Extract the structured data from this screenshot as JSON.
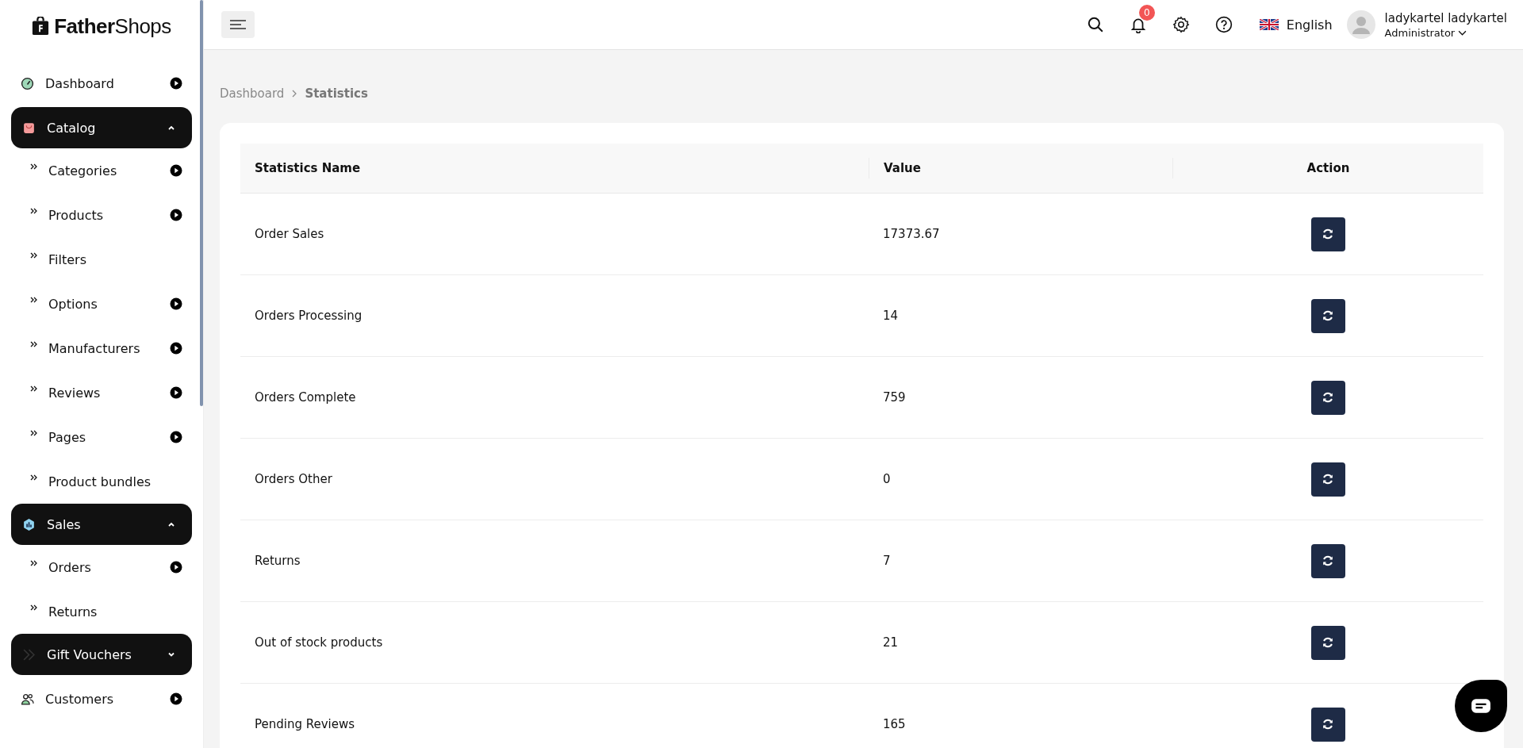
{
  "brand": {
    "name_bold": "Father",
    "name_light": "Shops"
  },
  "sidebar": {
    "items": [
      {
        "label": "Dashboard",
        "kind": "link",
        "has_arrow": true
      },
      {
        "label": "Catalog",
        "kind": "group",
        "expanded": true,
        "children": [
          {
            "label": "Categories",
            "has_arrow": true
          },
          {
            "label": "Products",
            "has_arrow": true
          },
          {
            "label": "Filters",
            "has_arrow": false
          },
          {
            "label": "Options",
            "has_arrow": true
          },
          {
            "label": "Manufacturers",
            "has_arrow": true
          },
          {
            "label": "Reviews",
            "has_arrow": true
          },
          {
            "label": "Pages",
            "has_arrow": true
          },
          {
            "label": "Product bundles",
            "has_arrow": false
          }
        ]
      },
      {
        "label": "Sales",
        "kind": "group",
        "expanded": true,
        "children": [
          {
            "label": "Orders",
            "has_arrow": true
          },
          {
            "label": "Returns",
            "has_arrow": false
          }
        ]
      },
      {
        "label": "Gift Vouchers",
        "kind": "group",
        "expanded": false
      },
      {
        "label": "Customers",
        "kind": "link",
        "has_arrow": true
      }
    ]
  },
  "header": {
    "notification_count": "0",
    "language": "English",
    "user_name": "ladykartel ladykartel",
    "user_role": "Administrator"
  },
  "breadcrumb": [
    {
      "label": "Dashboard",
      "current": false
    },
    {
      "label": "Statistics",
      "current": true
    }
  ],
  "table": {
    "columns": [
      "Statistics Name",
      "Value",
      "Action"
    ],
    "rows": [
      {
        "name": "Order Sales",
        "value": "17373.67"
      },
      {
        "name": "Orders Processing",
        "value": "14"
      },
      {
        "name": "Orders Complete",
        "value": "759"
      },
      {
        "name": "Orders Other",
        "value": "0"
      },
      {
        "name": "Returns",
        "value": "7"
      },
      {
        "name": "Out of stock products",
        "value": "21"
      },
      {
        "name": "Pending Reviews",
        "value": "165"
      }
    ]
  }
}
